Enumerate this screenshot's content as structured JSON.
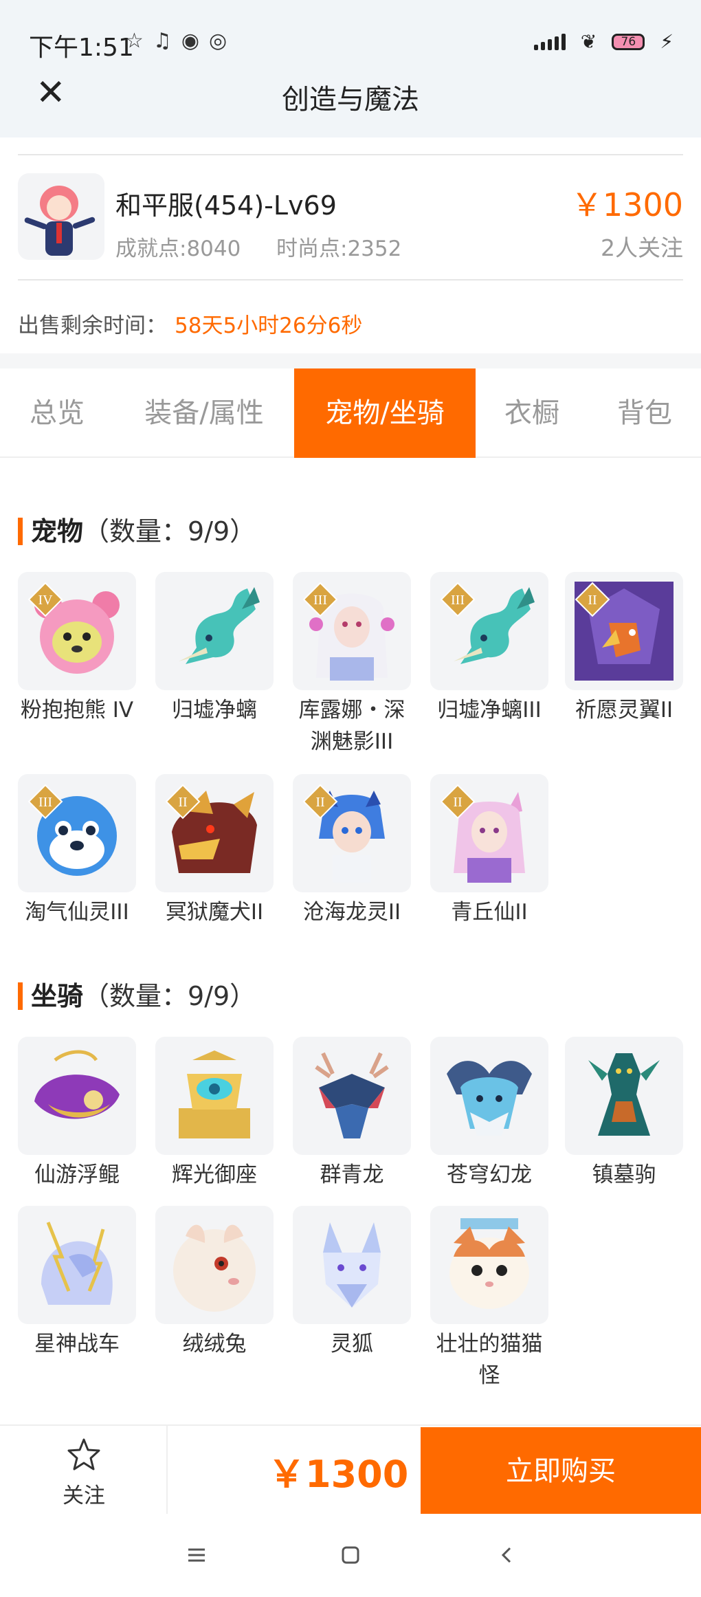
{
  "status_bar": {
    "time": "下午1:51",
    "battery": "76",
    "left_icons": [
      "star-icon",
      "bell-icon",
      "app-icon",
      "app-icon"
    ],
    "right_icons": [
      "signal-icon",
      "butterfly-icon",
      "battery-icon",
      "charging-icon"
    ]
  },
  "header": {
    "title": "创造与魔法",
    "close_icon": "close-icon"
  },
  "account": {
    "name": "和平服(454)-Lv69",
    "achievement": "成就点:8040",
    "fashion": "时尚点:2352",
    "price": "￥1300",
    "followers": "2人关注",
    "remaining_label": "出售剩余时间：",
    "remaining_value": "58天5小时26分6秒"
  },
  "tabs": [
    {
      "label": "总览",
      "active": false
    },
    {
      "label": "装备/属性",
      "active": false
    },
    {
      "label": "宠物/坐骑",
      "active": true
    },
    {
      "label": "衣橱",
      "active": false
    },
    {
      "label": "背包",
      "active": false
    }
  ],
  "pets": {
    "title": "宠物",
    "count": "（数量：9/9）",
    "items": [
      {
        "name": "粉抱抱熊 IV",
        "badge": "IV"
      },
      {
        "name": "归墟净螭",
        "badge": ""
      },
      {
        "name": "库露娜・深渊魅影III",
        "badge": "III"
      },
      {
        "name": "归墟净螭III",
        "badge": "III"
      },
      {
        "name": "祈愿灵翼II",
        "badge": "II"
      },
      {
        "name": "淘气仙灵III",
        "badge": "III"
      },
      {
        "name": "冥狱魔犬II",
        "badge": "II"
      },
      {
        "name": "沧海龙灵II",
        "badge": "II"
      },
      {
        "name": "青丘仙II",
        "badge": "II"
      }
    ]
  },
  "mounts": {
    "title": "坐骑",
    "count": "（数量：9/9）",
    "items": [
      {
        "name": "仙游浮鲲"
      },
      {
        "name": "辉光御座"
      },
      {
        "name": "群青龙"
      },
      {
        "name": "苍穹幻龙"
      },
      {
        "name": "镇墓驹"
      },
      {
        "name": "星神战车"
      },
      {
        "name": "绒绒兔"
      },
      {
        "name": "灵狐"
      },
      {
        "name": "壮壮的猫猫怪"
      }
    ]
  },
  "footer": {
    "follow_label": "关注",
    "price": "￥1300",
    "buy_label": "立即购买"
  },
  "colors": {
    "accent": "#ff6a00",
    "muted": "#999999",
    "background_header": "#f1f5f8"
  }
}
